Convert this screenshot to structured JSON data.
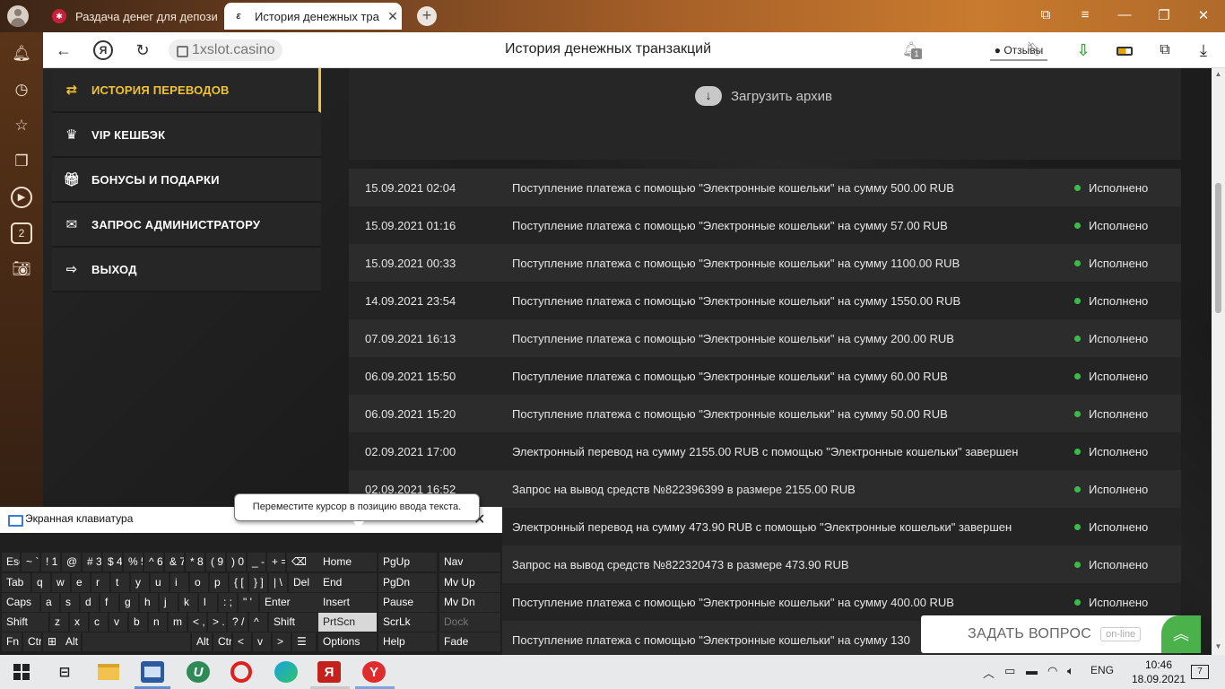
{
  "browser": {
    "tabs": [
      {
        "title": "Раздача денег для депози",
        "active": false
      },
      {
        "title": "История денежных тра",
        "active": true
      }
    ],
    "url": "1xslot.casino",
    "page_title": "История денежных транзакций",
    "reviews_label": "Отзывы",
    "notification_count": "1",
    "sidebar_badge": "2"
  },
  "menu": [
    {
      "label": "ИСТОРИЯ ПЕРЕВОДОВ",
      "icon": "transfer-icon",
      "active": true
    },
    {
      "label": "VIP КЕШБЭК",
      "icon": "crown-icon",
      "active": false
    },
    {
      "label": "БОНУСЫ И ПОДАРКИ",
      "icon": "gift-icon",
      "active": false
    },
    {
      "label": "ЗАПРОС АДМИНИСТРАТОРУ",
      "icon": "envelope-icon",
      "active": false
    },
    {
      "label": "ВЫХОД",
      "icon": "logout-icon",
      "active": false
    }
  ],
  "archive_label": "Загрузить архив",
  "transactions": [
    {
      "date": "15.09.2021 02:04",
      "desc": "Поступление платежа с помощью \"Электронные кошельки\" на сумму 500.00 RUB",
      "status": "Исполнено"
    },
    {
      "date": "15.09.2021 01:16",
      "desc": "Поступление платежа с помощью \"Электронные кошельки\" на сумму 57.00 RUB",
      "status": "Исполнено"
    },
    {
      "date": "15.09.2021 00:33",
      "desc": "Поступление платежа с помощью \"Электронные кошельки\" на сумму 1100.00 RUB",
      "status": "Исполнено"
    },
    {
      "date": "14.09.2021 23:54",
      "desc": "Поступление платежа с помощью \"Электронные кошельки\" на сумму 1550.00 RUB",
      "status": "Исполнено"
    },
    {
      "date": "07.09.2021 16:13",
      "desc": "Поступление платежа с помощью \"Электронные кошельки\" на сумму 200.00 RUB",
      "status": "Исполнено"
    },
    {
      "date": "06.09.2021 15:50",
      "desc": "Поступление платежа с помощью \"Электронные кошельки\" на сумму 60.00 RUB",
      "status": "Исполнено"
    },
    {
      "date": "06.09.2021 15:20",
      "desc": "Поступление платежа с помощью \"Электронные кошельки\" на сумму 50.00 RUB",
      "status": "Исполнено"
    },
    {
      "date": "02.09.2021 17:00",
      "desc": "Электронный перевод на сумму 2155.00 RUB с помощью \"Электронные кошельки\" завершен",
      "status": "Исполнено"
    },
    {
      "date": "02.09.2021 16:52",
      "desc": "Запрос на вывод средств №822396399 в размере 2155.00 RUB",
      "status": "Исполнено"
    },
    {
      "date": "",
      "desc": "Электронный перевод на сумму 473.90 RUB с помощью \"Электронные кошельки\" завершен",
      "status": "Исполнено"
    },
    {
      "date": "",
      "desc": "Запрос на вывод средств №822320473 в размере 473.90 RUB",
      "status": "Исполнено"
    },
    {
      "date": "",
      "desc": "Поступление платежа с помощью \"Электронные кошельки\" на сумму 400.00 RUB",
      "status": "Исполнено"
    },
    {
      "date": "",
      "desc": "Поступление платежа с помощью \"Электронные кошельки\" на сумму 130",
      "status": ""
    }
  ],
  "ask_widget": {
    "label": "ЗАДАТЬ ВОПРОС",
    "badge": "on-line"
  },
  "osk": {
    "title": "Экранная клавиатура",
    "tooltip": "Переместите курсор в позицию ввода текста.",
    "rows": [
      [
        "Esc",
        "~ `",
        "! 1",
        "@ 2",
        "# 3",
        "$ 4",
        "% 5",
        "^ 6",
        "& 7",
        "* 8",
        "( 9",
        ") 0",
        "_ -",
        "+ =",
        "⌫"
      ],
      [
        "Tab",
        "q",
        "w",
        "e",
        "r",
        "t",
        "y",
        "u",
        "i",
        "o",
        "p",
        "{ [",
        "} ]",
        "| \\",
        "Del"
      ],
      [
        "Caps",
        "a",
        "s",
        "d",
        "f",
        "g",
        "h",
        "j",
        "k",
        "l",
        ": ;",
        "\" '",
        "Enter"
      ],
      [
        "Shift",
        "z",
        "x",
        "c",
        "v",
        "b",
        "n",
        "m",
        "< ,",
        "> .",
        "? /",
        "^",
        "Shift"
      ],
      [
        "Fn",
        "Ctrl",
        "⊞",
        "Alt",
        "",
        "Alt",
        "Ctrl",
        "<",
        "v",
        ">",
        "☰"
      ]
    ],
    "side_keys": [
      [
        "Home",
        "PgUp",
        "Nav"
      ],
      [
        "End",
        "PgDn",
        "Mv Up"
      ],
      [
        "Insert",
        "Pause",
        "Mv Dn"
      ],
      [
        "PrtScn",
        "ScrLk",
        "Dock"
      ],
      [
        "Options",
        "Help",
        "Fade"
      ]
    ]
  },
  "taskbar": {
    "language": "ENG",
    "time": "10:46",
    "date": "18.09.2021",
    "notifications": "7"
  }
}
